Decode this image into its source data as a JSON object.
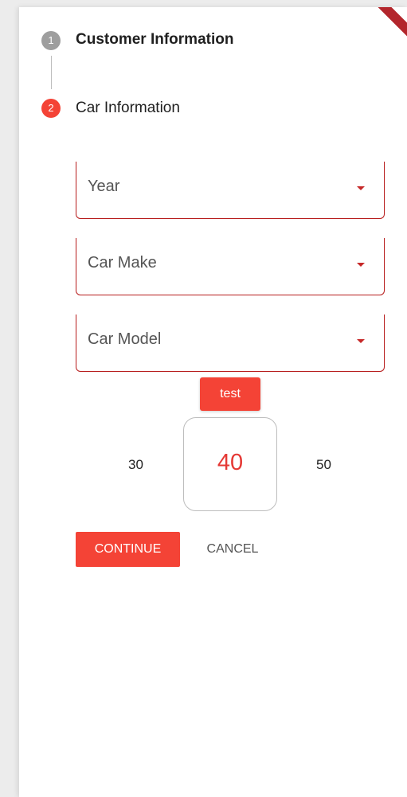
{
  "stepper": {
    "steps": [
      {
        "number": "1",
        "title": "Customer Information",
        "state": "completed",
        "color": "#9e9e9e"
      },
      {
        "number": "2",
        "title": "Car Information",
        "state": "active",
        "color": "#f44336"
      }
    ]
  },
  "form": {
    "year_dropdown": {
      "label": "Year"
    },
    "make_dropdown": {
      "label": "Car Make"
    },
    "model_dropdown": {
      "label": "Car Model"
    },
    "border_color": "#b71c1c"
  },
  "test_button": {
    "label": "test"
  },
  "number_picker": {
    "previous": "30",
    "selected": "40",
    "next": "50"
  },
  "actions": {
    "continue_label": "CONTINUE",
    "cancel_label": "CANCEL"
  },
  "colors": {
    "accent": "#f44336",
    "inactive_step": "#9e9e9e"
  },
  "debug_banner": {
    "icon": "debug-ribbon"
  }
}
